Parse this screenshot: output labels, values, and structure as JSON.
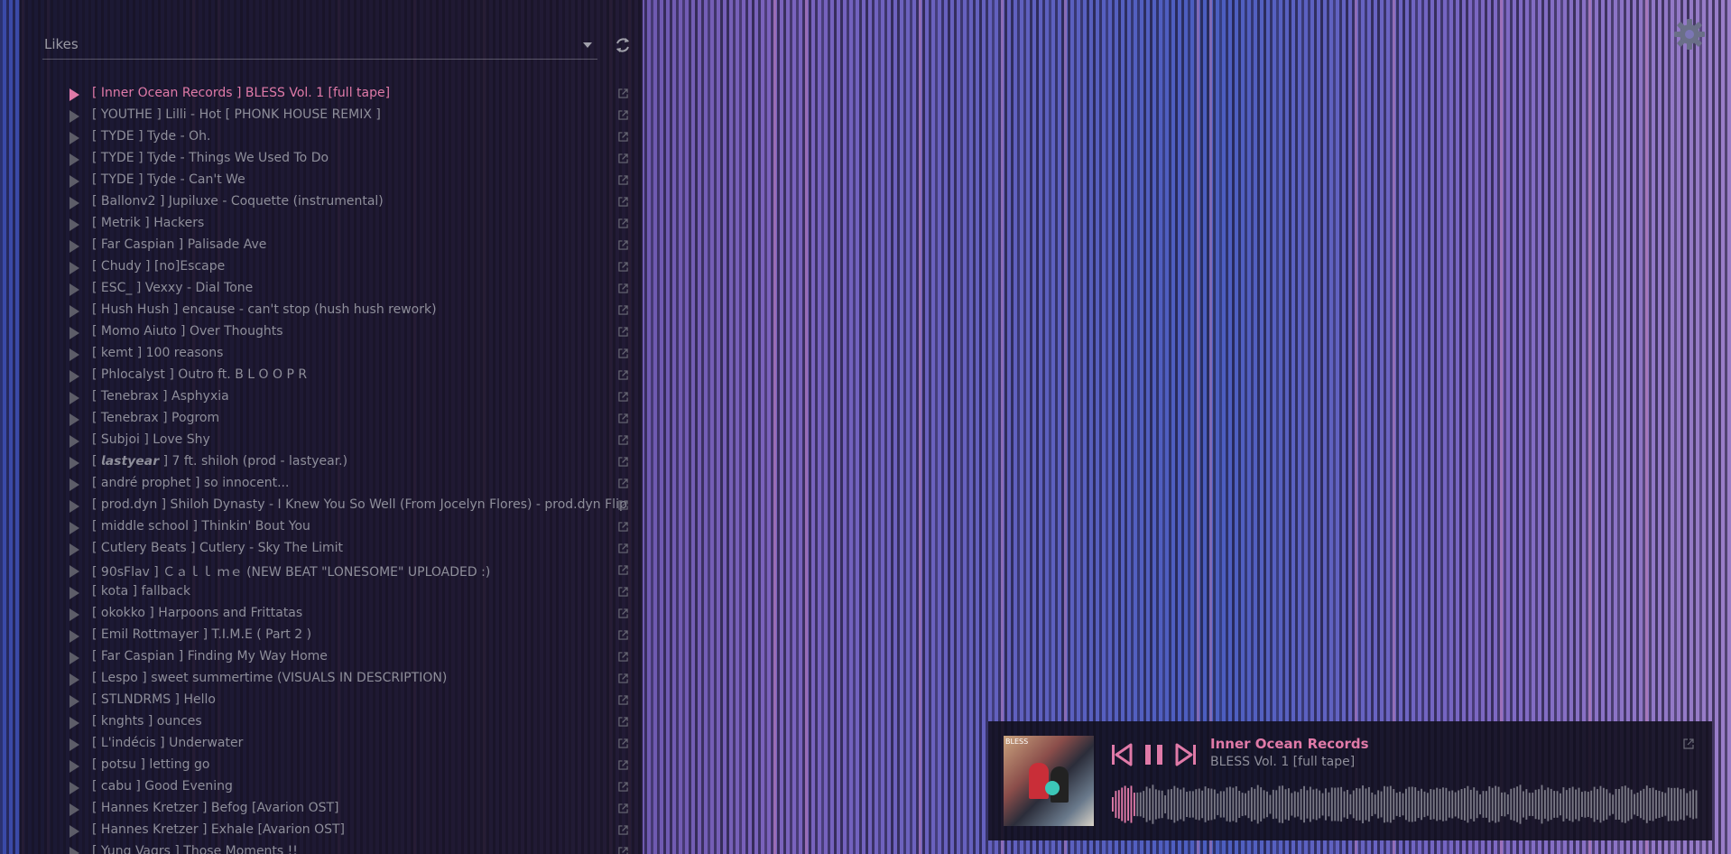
{
  "playlist": {
    "selected": "Likes"
  },
  "tracks": [
    {
      "title": "[ Inner Ocean Records ] BLESS Vol. 1 [full tape]",
      "active": true
    },
    {
      "title": "[ YOUTHE ] Lilli - Hot [ PHONK HOUSE REMIX ]"
    },
    {
      "title": "[ TYDE ] Tyde - Oh."
    },
    {
      "title": "[ TYDE ] Tyde - Things We Used To Do"
    },
    {
      "title": "[ TYDE ] Tyde - Can't We"
    },
    {
      "title": "[ Ballonv2 ] Jupiluxe - Coquette (instrumental)"
    },
    {
      "title": "[ Metrik ] Hackers"
    },
    {
      "title": "[ Far Caspian ] Palisade Ave"
    },
    {
      "title": "[ Chudy ] [no]Escape"
    },
    {
      "title": "[ ESC_ ] Vexxy - Dial Tone"
    },
    {
      "title": "[ Hush Hush ] encause - can't stop (hush hush rework)"
    },
    {
      "title": "[ Momo Aiuto ] Over Thoughts"
    },
    {
      "title": "[ kemt ] 100 reasons"
    },
    {
      "title": "[ Phlocalyst ] Outro ft. B L O O P R"
    },
    {
      "title": "[ Tenebrax ] Asphyxia"
    },
    {
      "title": "[ Tenebrax ] Pogrom"
    },
    {
      "title": "[ Subjoi ] Love Shy"
    },
    {
      "title": "[ 𝙡𝙖𝙨𝙩𝙮𝙚𝙖𝙧 ] 7 ft. shiloh (prod - lastyear.)"
    },
    {
      "title": "[ andré prophet ] so innocent..."
    },
    {
      "title": "[ prod.dyn ] Shiloh Dynasty - I Knew You So Well (From Jocelyn Flores) - prod.dyn Flip"
    },
    {
      "title": "[ middle school ] Thinkin' Bout You"
    },
    {
      "title": "[ Cutlery Beats ] Cutlery - Sky The Limit"
    },
    {
      "title": "[ 90sFlav ] Ｃａｌｌ ｍｅ (NEW BEAT \"LONESOME\" UPLOADED :)"
    },
    {
      "title": "[ kota ] fallback"
    },
    {
      "title": "[ okokko ] Harpoons and Frittatas"
    },
    {
      "title": "[ Emil Rottmayer ] T.I.M.E ( Part 2 )"
    },
    {
      "title": "[ Far Caspian ] Finding My Way Home"
    },
    {
      "title": "[ Lespo ] sweet summertime (VISUALS IN DESCRIPTION)"
    },
    {
      "title": "[ STLNDRMS ] Hello"
    },
    {
      "title": "[ knghts ] ounces"
    },
    {
      "title": "[ L'indécis ] Underwater"
    },
    {
      "title": "[ potsu ] letting go"
    },
    {
      "title": "[ cabu ] Good Evening"
    },
    {
      "title": "[ Hannes Kretzer ] Befog [Avarion OST]"
    },
    {
      "title": "[ Hannes Kretzer ] Exhale [Avarion OST]"
    },
    {
      "title": "[ Yung Vagrs ] Those Moments !!"
    }
  ],
  "player": {
    "artist": "Inner Ocean Records",
    "title": "BLESS Vol. 1 [full tape]",
    "art_label": "BLESS",
    "progress": 0.04,
    "state": "playing"
  },
  "icons": {
    "refresh": "refresh-icon",
    "settings": "gear-icon",
    "external": "external-link-icon",
    "prev": "skip-previous-icon",
    "pause": "pause-icon",
    "next": "skip-next-icon"
  },
  "colors": {
    "accent": "#e07aa8",
    "muted_text": "#8e8e9a",
    "panel": "#16121f",
    "bar_blue": "#3b4fa8",
    "bar_purple": "#7a5fb8",
    "bar_pink": "#c27aaa"
  }
}
